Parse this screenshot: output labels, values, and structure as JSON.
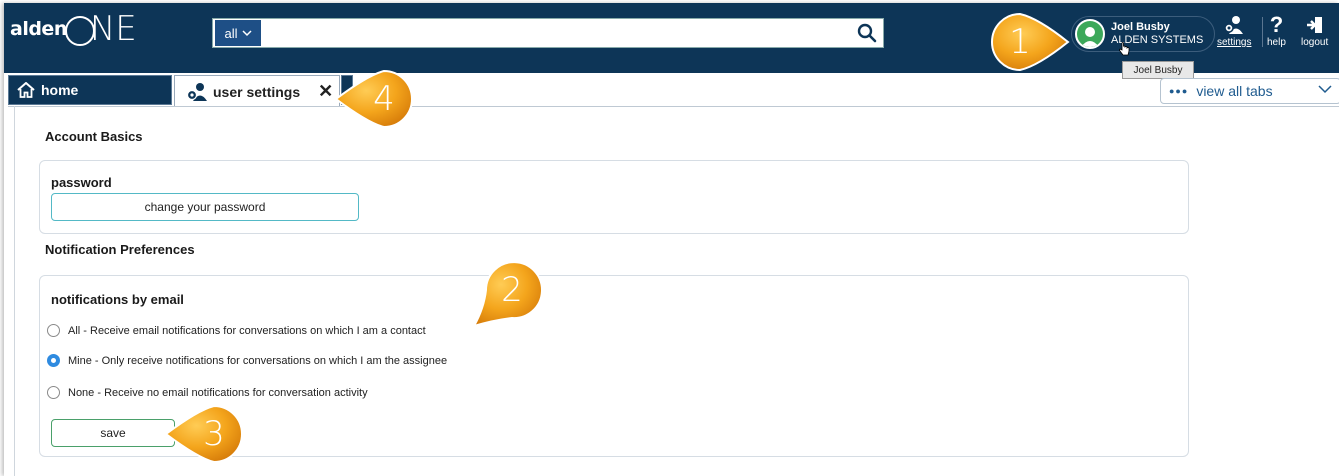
{
  "header": {
    "logo_text": "alden",
    "logo_one_o": "O",
    "logo_one_ne": "NE",
    "search": {
      "scope_label": "all",
      "query": "",
      "placeholder": ""
    },
    "user": {
      "name": "Joel Busby",
      "org": "ALDEN SYSTEMS",
      "tooltip": "Joel Busby"
    },
    "buttons": {
      "settings": "settings",
      "help": "help",
      "logout": "logout"
    }
  },
  "tabs": {
    "home": "home",
    "user_settings": "user settings",
    "close": "✕",
    "view_all": "view all tabs"
  },
  "content": {
    "account_basics": {
      "title": "Account Basics",
      "password_label": "password",
      "change_password_button": "change your password"
    },
    "notifications": {
      "title": "Notification Preferences",
      "card_title": "notifications by email",
      "options": [
        {
          "label": "All - Receive email notifications for conversations on which I am a contact",
          "checked": false
        },
        {
          "label": "Mine - Only receive notifications for conversations on which I am the assignee",
          "checked": true
        },
        {
          "label": "None - Receive no email notifications for conversation activity",
          "checked": false
        }
      ],
      "save_button": "save"
    }
  },
  "callouts": [
    "1",
    "2",
    "3",
    "4"
  ],
  "colors": {
    "header_bg": "#0d3557",
    "accent_teal": "#53b9c6",
    "radio_checked": "#2f8be0",
    "callout_orange": "#f0a020",
    "avatar_green": "#3ca85a"
  }
}
